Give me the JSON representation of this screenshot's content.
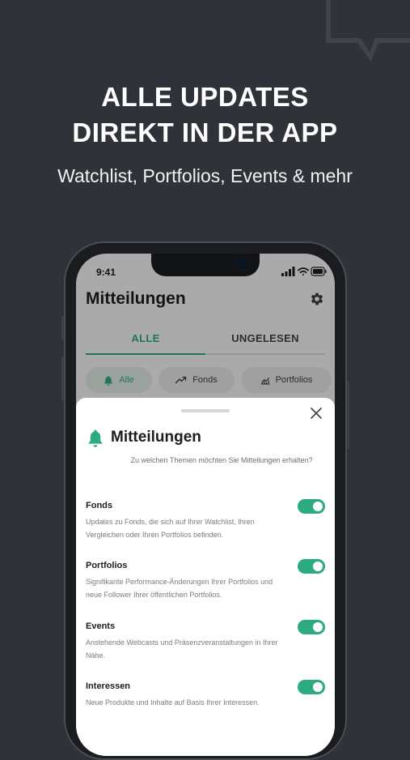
{
  "headline": {
    "line1": "ALLE UPDATES",
    "line2": "DIREKT IN DER APP",
    "subtitle": "Watchlist, Portfolios, Events & mehr"
  },
  "status_bar": {
    "time": "9:41"
  },
  "app": {
    "title": "Mitteilungen",
    "tabs": [
      {
        "label": "ALLE",
        "active": true
      },
      {
        "label": "UNGELESEN",
        "active": false
      }
    ],
    "chips": [
      {
        "label": "Alle",
        "icon": "bell-icon",
        "active": true
      },
      {
        "label": "Fonds",
        "icon": "trend-icon",
        "active": false
      },
      {
        "label": "Portfolios",
        "icon": "chart-icon",
        "active": false
      }
    ]
  },
  "sheet": {
    "title": "Mitteilungen",
    "subtitle": "Zu welchen Themen möchten Sie Mitteilungen erhalten?",
    "items": [
      {
        "title": "Fonds",
        "description": "Updates zu Fonds, die sich auf Ihrer Watchlist, Ihren Vergleichen oder Ihren Portfolios befinden.",
        "enabled": true
      },
      {
        "title": "Portfolios",
        "description": "Signifikante Performance-Änderungen Ihrer Portfolios und neue Follower Ihrer öffentlichen Portfolios.",
        "enabled": true
      },
      {
        "title": "Events",
        "description": "Anstehende Webcasts und Präsenzveranstaltungen in Ihrer Nähe.",
        "enabled": true
      },
      {
        "title": "Interessen",
        "description": "Neue Produkte und Inhalte auf Basis Ihrer Interessen.",
        "enabled": true
      }
    ]
  },
  "colors": {
    "accent": "#2eaa7f",
    "background": "#2f3238"
  }
}
